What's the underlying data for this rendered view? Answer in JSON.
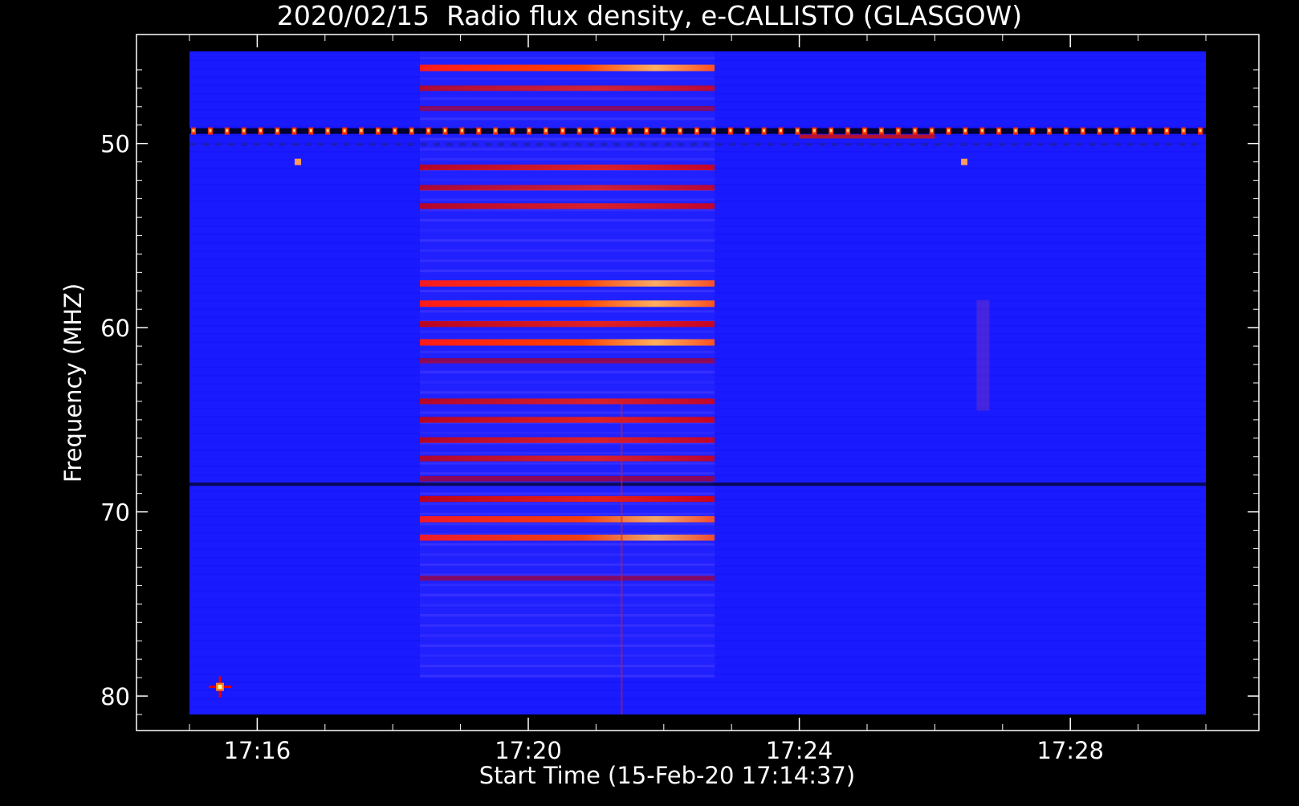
{
  "chart_data": {
    "type": "heatmap",
    "title": "2020/02/15  Radio flux density, e-CALLISTO (GLASGOW)",
    "xlabel": "Start Time (15-Feb-20 17:14:37)",
    "ylabel": "Frequency (MHZ)",
    "x_range_minutes": [
      "17:15",
      "17:30"
    ],
    "ylim": [
      45,
      81
    ],
    "y_inverted": true,
    "x_ticks": [
      "17:16",
      "17:20",
      "17:24",
      "17:28"
    ],
    "y_ticks": [
      50,
      60,
      70,
      80
    ],
    "colormap": [
      "#0000ff",
      "#ff0000",
      "#ffff99"
    ],
    "background_color": "#1a1aff",
    "burst_interval": {
      "start": "17:18:24",
      "end": "17:22:45",
      "freq_range": [
        45,
        79
      ]
    },
    "emission_lines_in_burst": [
      {
        "freq": 45.9,
        "intensity": 1.0
      },
      {
        "freq": 47.0,
        "intensity": 0.6
      },
      {
        "freq": 48.1,
        "intensity": 0.4
      },
      {
        "freq": 51.3,
        "intensity": 0.7
      },
      {
        "freq": 52.4,
        "intensity": 0.6
      },
      {
        "freq": 53.4,
        "intensity": 0.7
      },
      {
        "freq": 57.6,
        "intensity": 0.95
      },
      {
        "freq": 58.7,
        "intensity": 1.0
      },
      {
        "freq": 59.8,
        "intensity": 0.75
      },
      {
        "freq": 60.8,
        "intensity": 1.0
      },
      {
        "freq": 61.8,
        "intensity": 0.5
      },
      {
        "freq": 64.0,
        "intensity": 0.7
      },
      {
        "freq": 65.0,
        "intensity": 0.75
      },
      {
        "freq": 66.1,
        "intensity": 0.7
      },
      {
        "freq": 67.1,
        "intensity": 0.65
      },
      {
        "freq": 68.2,
        "intensity": 0.55
      },
      {
        "freq": 69.3,
        "intensity": 0.8
      },
      {
        "freq": 70.4,
        "intensity": 0.9
      },
      {
        "freq": 71.4,
        "intensity": 0.85
      },
      {
        "freq": 73.6,
        "intensity": 0.4
      }
    ],
    "persistent_interference_freq": 49.3,
    "dark_band_freq": 68.5,
    "persistent_interference_interval": {
      "start": "17:15",
      "end": "17:30"
    },
    "highlight_segment": {
      "freq": 49.6,
      "start": "17:24",
      "end": "17:26"
    },
    "point_sources": [
      {
        "time": "17:16:36",
        "freq": 51.0
      },
      {
        "time": "17:26:26",
        "freq": 51.0
      },
      {
        "time": "17:15:27",
        "freq": 79.5
      }
    ]
  }
}
